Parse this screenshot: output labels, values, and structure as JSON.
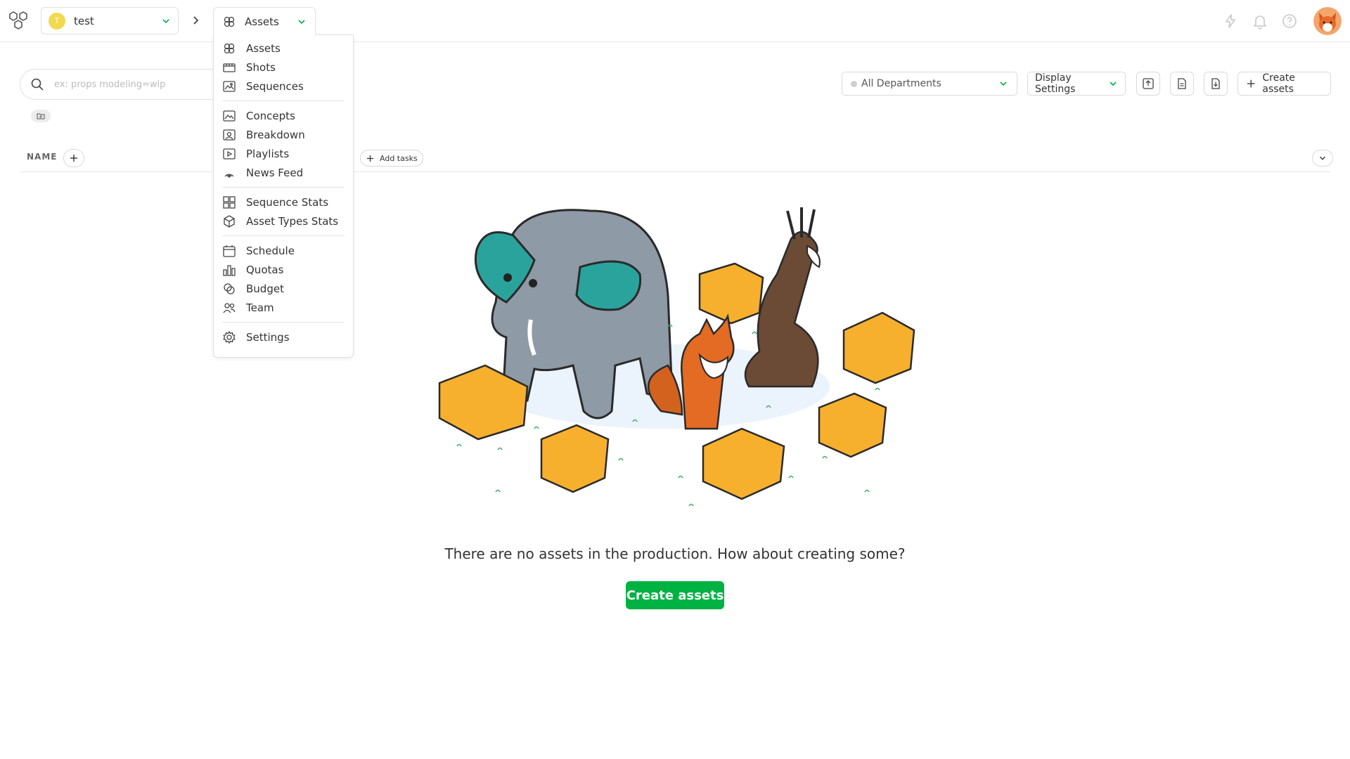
{
  "topbar": {
    "production": {
      "initial": "T",
      "name": "test"
    },
    "section": {
      "label": "Assets"
    }
  },
  "menu": {
    "groups": [
      [
        {
          "label": "Assets",
          "icon": "assets-icon"
        },
        {
          "label": "Shots",
          "icon": "shots-icon"
        },
        {
          "label": "Sequences",
          "icon": "sequences-icon"
        }
      ],
      [
        {
          "label": "Concepts",
          "icon": "concepts-icon"
        },
        {
          "label": "Breakdown",
          "icon": "breakdown-icon"
        },
        {
          "label": "Playlists",
          "icon": "playlists-icon"
        },
        {
          "label": "News Feed",
          "icon": "news-feed-icon"
        }
      ],
      [
        {
          "label": "Sequence Stats",
          "icon": "sequence-stats-icon"
        },
        {
          "label": "Asset Types Stats",
          "icon": "asset-types-stats-icon"
        }
      ],
      [
        {
          "label": "Schedule",
          "icon": "calendar-icon"
        },
        {
          "label": "Quotas",
          "icon": "quotas-icon"
        },
        {
          "label": "Budget",
          "icon": "budget-icon"
        },
        {
          "label": "Team",
          "icon": "team-icon"
        }
      ],
      [
        {
          "label": "Settings",
          "icon": "gear-icon"
        }
      ]
    ]
  },
  "toolbar": {
    "search_placeholder": "ex: props modeling=wip",
    "department": "All Departments",
    "display_settings": "Display Settings",
    "create_assets": "Create assets"
  },
  "table": {
    "name_header": "NAME",
    "add_tasks": "Add tasks"
  },
  "empty_state": {
    "message": "There are no assets in the production. How about creating some?",
    "button": "Create assets"
  },
  "colors": {
    "accent_green": "#00b242",
    "production_avatar": "#f2d94e"
  }
}
